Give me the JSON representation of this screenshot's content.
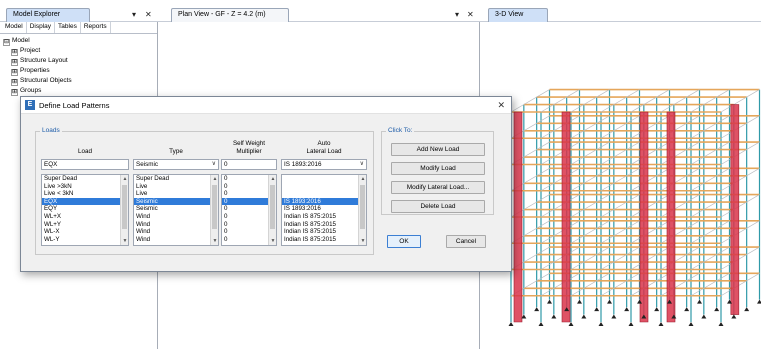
{
  "panes": {
    "explorer_title": "Model Explorer",
    "plan_title": "Plan View - GF - Z = 4.2 (m)",
    "view3d_title": "3-D View",
    "pin_symbol": "▾",
    "close_symbol": "✕"
  },
  "explorer": {
    "tabs": [
      "Model",
      "Display",
      "Tables",
      "Reports"
    ],
    "tree": [
      {
        "sign": "⊟",
        "label": "Model",
        "level": 0
      },
      {
        "sign": "⊞",
        "label": "Project",
        "level": 1
      },
      {
        "sign": "⊞",
        "label": "Structure Layout",
        "level": 1
      },
      {
        "sign": "⊞",
        "label": "Properties",
        "level": 1
      },
      {
        "sign": "⊞",
        "label": "Structural Objects",
        "level": 1
      },
      {
        "sign": "⊞",
        "label": "Groups",
        "level": 1
      }
    ]
  },
  "dialog": {
    "title": "Define Load Patterns",
    "icon_letter": "E",
    "close": "✕",
    "loads_group": "Loads",
    "clickto_group": "Click To:",
    "col_load": "Load",
    "col_type": "Type",
    "col_multiplier_1": "Self Weight",
    "col_multiplier_2": "Multiplier",
    "col_auto_1": "Auto",
    "col_auto_2": "Lateral Load",
    "edit_load": "EQX",
    "edit_type": "Seismic",
    "edit_multiplier": "0",
    "edit_auto": "IS 1893:2016",
    "rows": [
      {
        "load": "Super Dead",
        "type": "Super Dead",
        "mult": "0",
        "auto": ""
      },
      {
        "load": "Live >3kN",
        "type": "Live",
        "mult": "0",
        "auto": ""
      },
      {
        "load": "Live < 3kN",
        "type": "Live",
        "mult": "0",
        "auto": ""
      },
      {
        "load": "EQX",
        "type": "Seismic",
        "mult": "0",
        "auto": "IS 1893:2016"
      },
      {
        "load": "EQY",
        "type": "Seismic",
        "mult": "0",
        "auto": "IS 1893:2016"
      },
      {
        "load": "WL+X",
        "type": "Wind",
        "mult": "0",
        "auto": "Indian IS 875:2015"
      },
      {
        "load": "WL+Y",
        "type": "Wind",
        "mult": "0",
        "auto": "Indian IS 875:2015"
      },
      {
        "load": "WL-X",
        "type": "Wind",
        "mult": "0",
        "auto": "Indian IS 875:2015"
      },
      {
        "load": "WL-Y",
        "type": "Wind",
        "mult": "0",
        "auto": "Indian IS 875:2015"
      }
    ],
    "selected_row": 3,
    "buttons": {
      "add": "Add New Load",
      "modify": "Modify Load",
      "modify_lateral": "Modify Lateral Load...",
      "delete": "Delete Load",
      "ok": "OK",
      "cancel": "Cancel"
    }
  },
  "colors": {
    "selection": "#2f7bd9",
    "shear_wall": "#d9344a",
    "beam": "#e5a65a",
    "column": "#2f9aa8",
    "group_label": "#1c5ba8"
  }
}
